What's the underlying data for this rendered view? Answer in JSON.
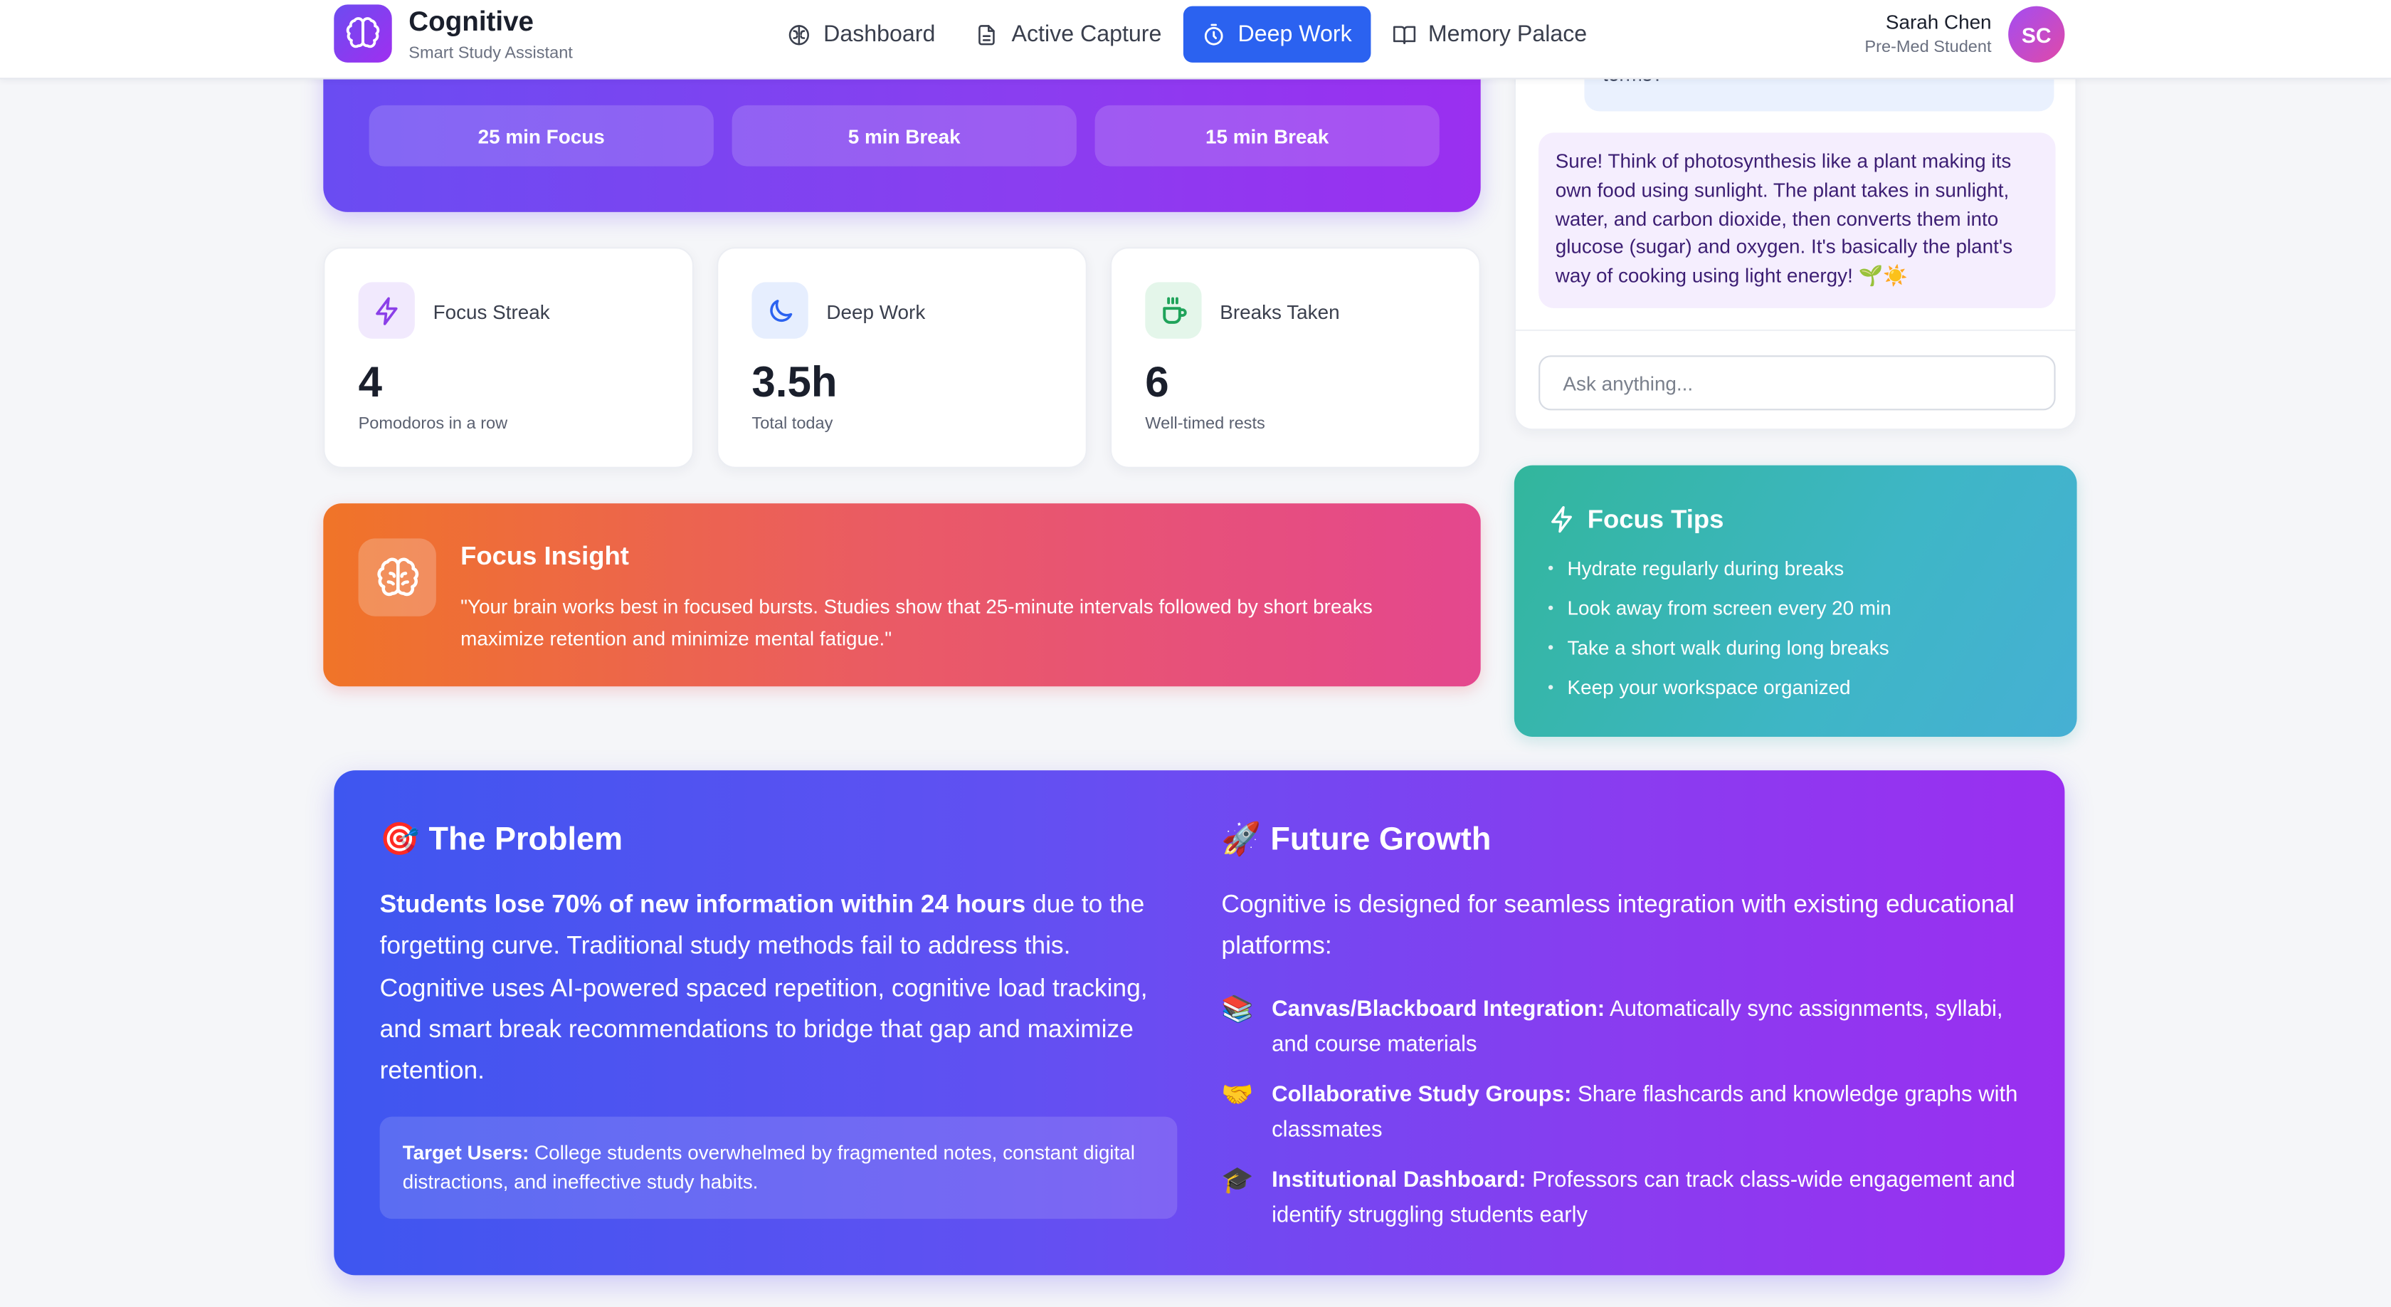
{
  "header": {
    "brand_name": "Cognitive",
    "brand_sub": "Smart Study Assistant",
    "nav": [
      {
        "label": "Dashboard",
        "icon": "brain-icon"
      },
      {
        "label": "Active Capture",
        "icon": "document-icon"
      },
      {
        "label": "Deep Work",
        "icon": "timer-icon",
        "active": true
      },
      {
        "label": "Memory Palace",
        "icon": "book-icon"
      }
    ],
    "user_name": "Sarah Chen",
    "user_role": "Pre-Med Student",
    "avatar_initials": "SC"
  },
  "timer": {
    "presets": [
      "25 min Focus",
      "5 min Break",
      "15 min Break"
    ]
  },
  "stats": [
    {
      "label": "Focus Streak",
      "value": "4",
      "sub": "Pomodoros in a row",
      "icon": "lightning-icon",
      "color": "#8b3fe8"
    },
    {
      "label": "Deep Work",
      "value": "3.5h",
      "sub": "Total today",
      "icon": "moon-icon",
      "color": "#2b62f0"
    },
    {
      "label": "Breaks Taken",
      "value": "6",
      "sub": "Well-timed rests",
      "icon": "coffee-icon",
      "color": "#1fa35a"
    }
  ],
  "insight": {
    "title": "Focus Insight",
    "text": "\"Your brain works best in focused bursts. Studies show that 25-minute intervals followed by short breaks maximize retention and minimize mental fatigue.\""
  },
  "chat": {
    "user_message_tail": "terms?",
    "ai_message": "Sure! Think of photosynthesis like a plant making its own food using sunlight. The plant takes in sunlight, water, and carbon dioxide, then converts them into glucose (sugar) and oxygen. It's basically the plant's way of cooking using light energy! 🌱☀️",
    "input_placeholder": "Ask anything..."
  },
  "tips": {
    "title": "Focus Tips",
    "items": [
      "Hydrate regularly during breaks",
      "Look away from screen every 20 min",
      "Take a short walk during long breaks",
      "Keep your workspace organized"
    ]
  },
  "problem": {
    "emoji": "🎯",
    "title": "The Problem",
    "lead_bold": "Students lose 70% of new information within 24 hours",
    "lead_rest": " due to the forgetting curve. Traditional study methods fail to address this. Cognitive uses AI-powered spaced repetition, cognitive load tracking, and smart break recommendations to bridge that gap and maximize retention.",
    "target_label": "Target Users:",
    "target_text": " College students overwhelmed by fragmented notes, constant digital distractions, and ineffective study habits."
  },
  "growth": {
    "emoji": "🚀",
    "title": "Future Growth",
    "intro": "Cognitive is designed for seamless integration with existing educational platforms:",
    "items": [
      {
        "emoji": "📚",
        "label": "Canvas/Blackboard Integration:",
        "text": " Automatically sync assignments, syllabi, and course materials"
      },
      {
        "emoji": "🤝",
        "label": "Collaborative Study Groups:",
        "text": " Share flashcards and knowledge graphs with classmates"
      },
      {
        "emoji": "🎓",
        "label": "Institutional Dashboard:",
        "text": " Professors can track class-wide engagement and identify struggling students early"
      }
    ]
  }
}
